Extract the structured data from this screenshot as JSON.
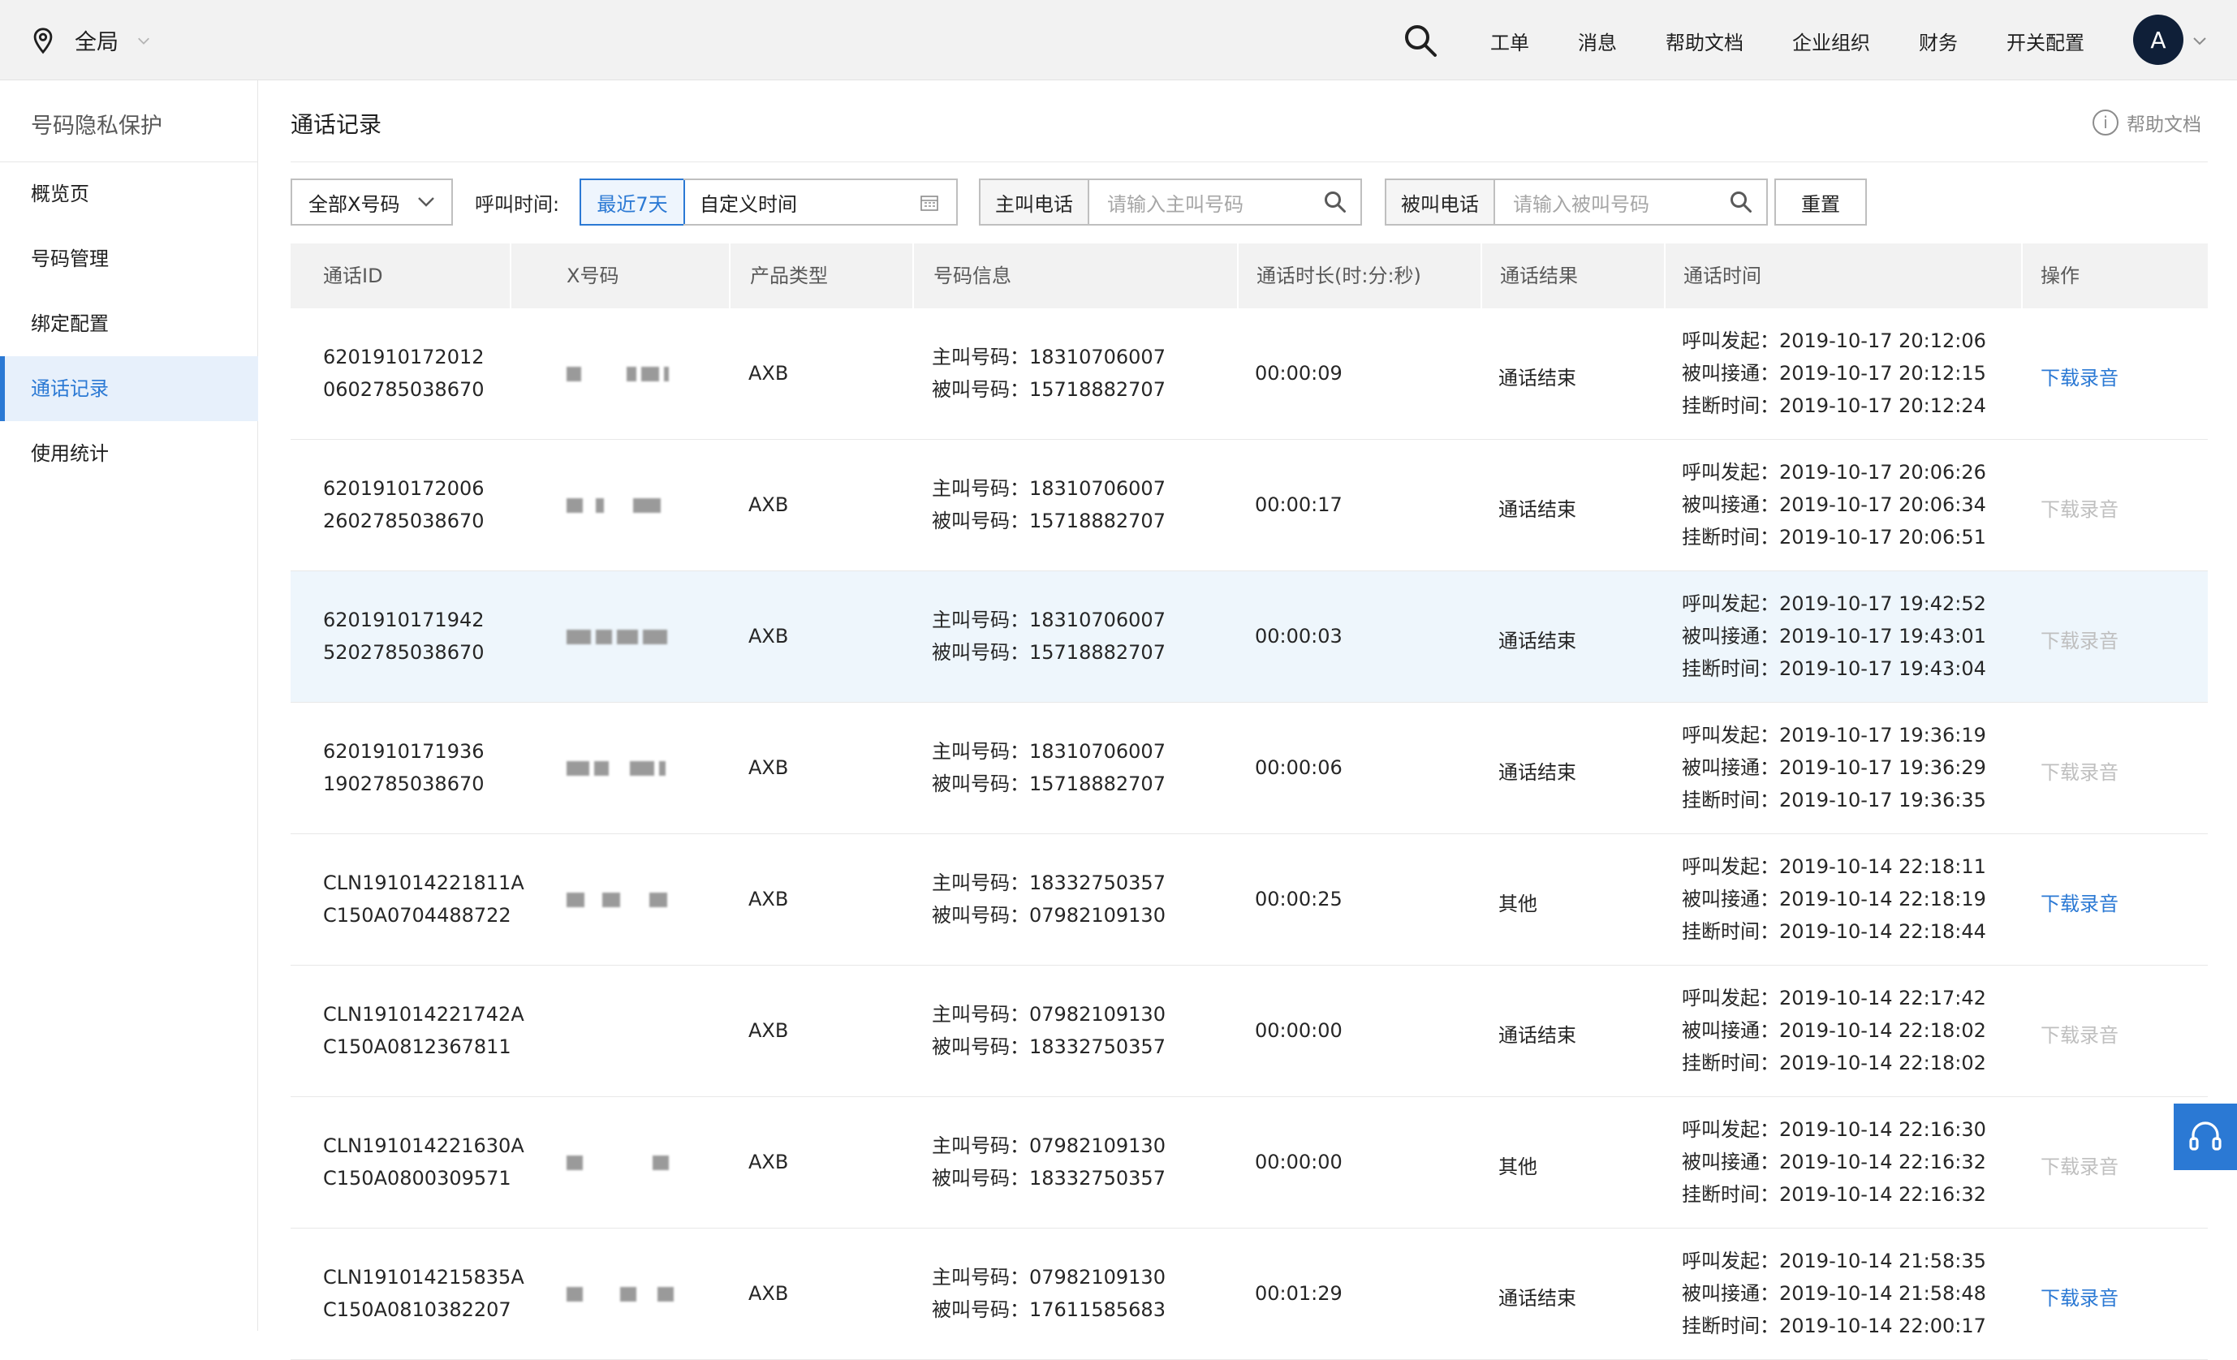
{
  "topbar": {
    "location": "全局",
    "nav": [
      "工单",
      "消息",
      "帮助文档",
      "企业组织",
      "财务",
      "开关配置"
    ],
    "avatar_letter": "A"
  },
  "sidebar": {
    "title": "号码隐私保护",
    "items": [
      {
        "label": "概览页",
        "active": false
      },
      {
        "label": "号码管理",
        "active": false
      },
      {
        "label": "绑定配置",
        "active": false
      },
      {
        "label": "通话记录",
        "active": true
      },
      {
        "label": "使用统计",
        "active": false
      }
    ]
  },
  "page": {
    "title": "通话记录",
    "help": "帮助文档"
  },
  "filters": {
    "x_select": "全部X号码",
    "time_label": "呼叫时间:",
    "recent_7": "最近7天",
    "custom_time": "自定义时间",
    "caller_label": "主叫电话",
    "caller_placeholder": "请输入主叫号码",
    "callee_label": "被叫电话",
    "callee_placeholder": "请输入被叫号码",
    "reset": "重置"
  },
  "table": {
    "columns": [
      "通话ID",
      "X号码",
      "产品类型",
      "号码信息",
      "通话时长(时:分:秒)",
      "通话结果",
      "通话时间",
      "操作"
    ],
    "caller_prefix": "主叫号码：",
    "callee_prefix": "被叫号码：",
    "start_prefix": "呼叫发起：",
    "answer_prefix": "被叫接通：",
    "hang_prefix": "挂断时间：",
    "download": "下载录音",
    "rows": [
      {
        "id1": "6201910172012",
        "id2": "0602785038670",
        "type": "AXB",
        "caller": "18310706007",
        "callee": "15718882707",
        "duration": "00:00:09",
        "result": "通话结束",
        "start": "2019-10-17 20:12:06",
        "answer": "2019-10-17 20:12:15",
        "hang": "2019-10-17 20:12:24",
        "download_enabled": true
      },
      {
        "id1": "6201910172006",
        "id2": "2602785038670",
        "type": "AXB",
        "caller": "18310706007",
        "callee": "15718882707",
        "duration": "00:00:17",
        "result": "通话结束",
        "start": "2019-10-17 20:06:26",
        "answer": "2019-10-17 20:06:34",
        "hang": "2019-10-17 20:06:51",
        "download_enabled": false
      },
      {
        "id1": "6201910171942",
        "id2": "5202785038670",
        "type": "AXB",
        "caller": "18310706007",
        "callee": "15718882707",
        "duration": "00:00:03",
        "result": "通话结束",
        "start": "2019-10-17 19:42:52",
        "answer": "2019-10-17 19:43:01",
        "hang": "2019-10-17 19:43:04",
        "download_enabled": false
      },
      {
        "id1": "6201910171936",
        "id2": "1902785038670",
        "type": "AXB",
        "caller": "18310706007",
        "callee": "15718882707",
        "duration": "00:00:06",
        "result": "通话结束",
        "start": "2019-10-17 19:36:19",
        "answer": "2019-10-17 19:36:29",
        "hang": "2019-10-17 19:36:35",
        "download_enabled": false
      },
      {
        "id1": "CLN191014221811A",
        "id2": "C150A0704488722",
        "type": "AXB",
        "caller": "18332750357",
        "callee": "07982109130",
        "duration": "00:00:25",
        "result": "其他",
        "start": "2019-10-14 22:18:11",
        "answer": "2019-10-14 22:18:19",
        "hang": "2019-10-14 22:18:44",
        "download_enabled": true
      },
      {
        "id1": "CLN191014221742A",
        "id2": "C150A0812367811",
        "type": "AXB",
        "caller": "07982109130",
        "callee": "18332750357",
        "duration": "00:00:00",
        "result": "通话结束",
        "start": "2019-10-14 22:17:42",
        "answer": "2019-10-14 22:18:02",
        "hang": "2019-10-14 22:18:02",
        "download_enabled": false
      },
      {
        "id1": "CLN191014221630A",
        "id2": "C150A0800309571",
        "type": "AXB",
        "caller": "07982109130",
        "callee": "18332750357",
        "duration": "00:00:00",
        "result": "其他",
        "start": "2019-10-14 22:16:30",
        "answer": "2019-10-14 22:16:32",
        "hang": "2019-10-14 22:16:32",
        "download_enabled": false
      },
      {
        "id1": "CLN191014215835A",
        "id2": "C150A0810382207",
        "type": "AXB",
        "caller": "07982109130",
        "callee": "17611585683",
        "duration": "00:01:29",
        "result": "通话结束",
        "start": "2019-10-14 21:58:35",
        "answer": "2019-10-14 21:58:48",
        "hang": "2019-10-14 22:00:17",
        "download_enabled": true
      }
    ]
  },
  "colors": {
    "accent": "#2b79d4",
    "disabled": "#bfbfbf",
    "highlight_row": "#eef6fc"
  }
}
